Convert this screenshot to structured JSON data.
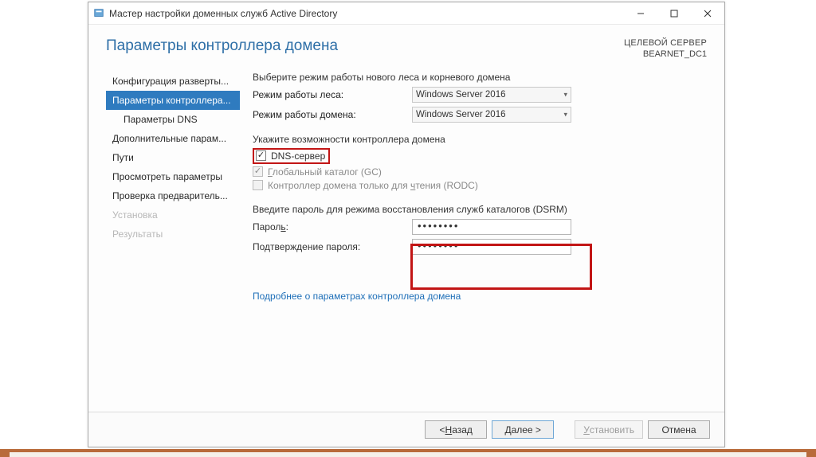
{
  "titlebar": {
    "title": "Мастер настройки доменных служб Active Directory"
  },
  "header": {
    "heading": "Параметры контроллера домена",
    "target_label": "ЦЕЛЕВОЙ СЕРВЕР",
    "target_server": "BEARNET_DC1"
  },
  "steps": {
    "s1": "Конфигурация разверты...",
    "s2": "Параметры контроллера...",
    "s3": "Параметры DNS",
    "s4": "Дополнительные парам...",
    "s5": "Пути",
    "s6": "Просмотреть параметры",
    "s7": "Проверка предваритель...",
    "s8": "Установка",
    "s9": "Результаты"
  },
  "content": {
    "intro": "Выберите режим работы нового леса и корневого домена",
    "forest_label": "Режим работы леса:",
    "domain_label": "Режим работы домена:",
    "forest_value": "Windows Server 2016",
    "domain_value": "Windows Server 2016",
    "cap_label": "Укажите возможности контроллера домена",
    "dns_label": "DNS-сервер",
    "gc_prefix": "Г",
    "gc_rest": "лобальный каталог (GC)",
    "rodc_prefix": "Контроллер домена только для ",
    "rodc_under": "ч",
    "rodc_suffix": "тения (RODC)",
    "dsrm_label": "Введите пароль для режима восстановления служб каталогов (DSRM)",
    "pw_label_pre": "Парол",
    "pw_label_u": "ь",
    "pw_label_post": ":",
    "pwc_label": "Подтверждение пароля:",
    "pw_value": "••••••••",
    "pwc_value": "••••••••",
    "link": "Подробнее о параметрах контроллера домена"
  },
  "footer": {
    "back_pre": "< ",
    "back_u": "Н",
    "back_post": "азад",
    "next_u": "Д",
    "next_post": "алее >",
    "install_u": "У",
    "install_post": "становить",
    "cancel": "Отмена"
  }
}
